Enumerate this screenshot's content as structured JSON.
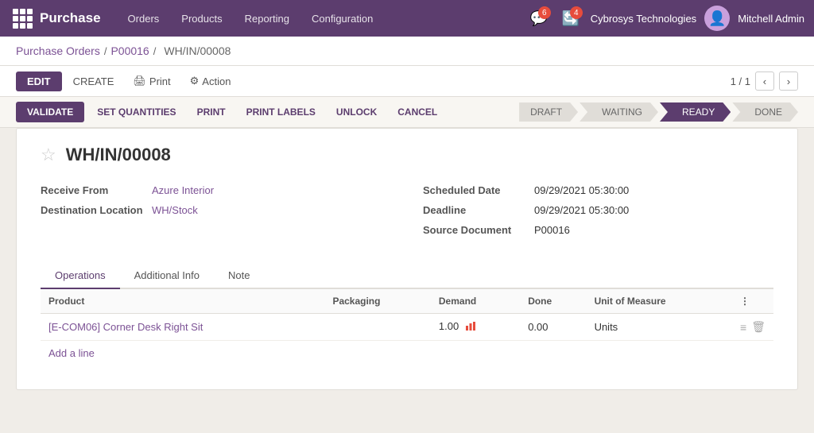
{
  "topnav": {
    "brand": "Purchase",
    "menu": [
      "Orders",
      "Products",
      "Reporting",
      "Configuration"
    ],
    "notifications": [
      {
        "icon": "💬",
        "count": "6"
      },
      {
        "icon": "🔄",
        "count": "4"
      }
    ],
    "company": "Cybrosys Technologies",
    "user": "Mitchell Admin"
  },
  "breadcrumb": {
    "items": [
      "Purchase Orders",
      "P00016"
    ],
    "current": "WH/IN/00008"
  },
  "toolbar": {
    "edit_label": "EDIT",
    "create_label": "CREATE",
    "print_label": "Print",
    "action_label": "Action",
    "pagination": "1 / 1"
  },
  "statusbar": {
    "validate_label": "VALIDATE",
    "set_quantities_label": "SET QUANTITIES",
    "print_label": "PRINT",
    "print_labels_label": "PRINT LABELS",
    "unlock_label": "UNLOCK",
    "cancel_label": "CANCEL",
    "pipeline": [
      "DRAFT",
      "WAITING",
      "READY",
      "DONE"
    ],
    "active_step": "READY"
  },
  "form": {
    "record_id": "WH/IN/00008",
    "fields_left": [
      {
        "label": "Receive From",
        "value": "Azure Interior",
        "link": true
      },
      {
        "label": "Destination Location",
        "value": "WH/Stock",
        "link": true
      }
    ],
    "fields_right": [
      {
        "label": "Scheduled Date",
        "value": "09/29/2021 05:30:00",
        "link": false
      },
      {
        "label": "Deadline",
        "value": "09/29/2021 05:30:00",
        "link": false
      },
      {
        "label": "Source Document",
        "value": "P00016",
        "link": false
      }
    ]
  },
  "tabs": [
    {
      "label": "Operations",
      "active": true
    },
    {
      "label": "Additional Info",
      "active": false
    },
    {
      "label": "Note",
      "active": false
    }
  ],
  "table": {
    "columns": [
      "Product",
      "Packaging",
      "Demand",
      "Done",
      "Unit of Measure"
    ],
    "rows": [
      {
        "product": "[E-COM06] Corner Desk Right Sit",
        "packaging": "",
        "demand": "1.00",
        "done": "0.00",
        "unit_of_measure": "Units"
      }
    ],
    "add_line_label": "Add a line"
  }
}
